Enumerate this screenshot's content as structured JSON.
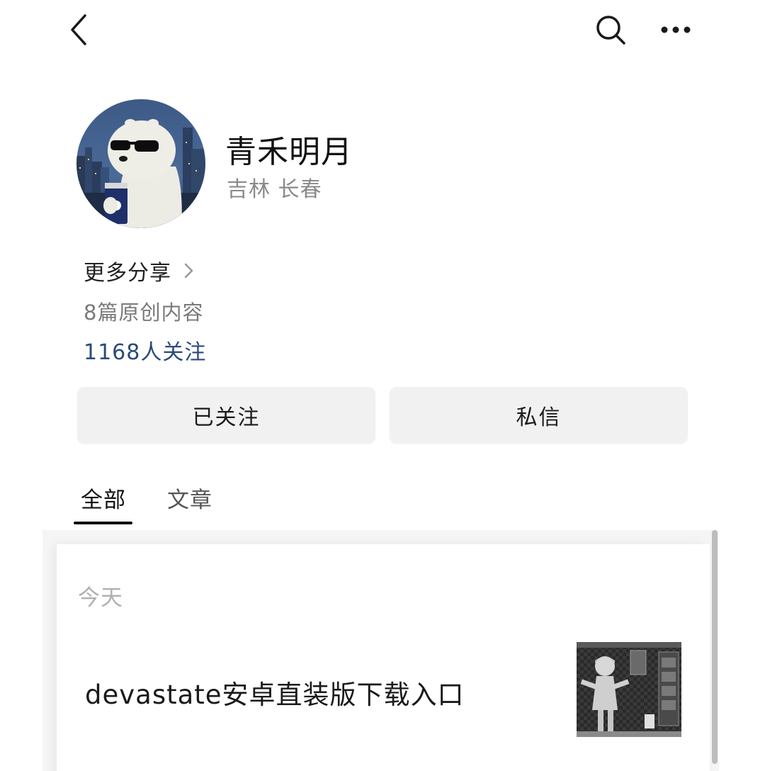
{
  "topbar": {
    "back_icon": "chevron-left-icon",
    "search_icon": "search-icon",
    "more_icon": "more-horizontal-icon"
  },
  "profile": {
    "name": "青禾明月",
    "location": "吉林 长春",
    "avatar_icon": "polar-bear-avatar"
  },
  "info": {
    "more_share": "更多分享",
    "original_count": "8篇原创内容",
    "followers": "1168人关注"
  },
  "actions": {
    "followed": "已关注",
    "message": "私信"
  },
  "tabs": [
    {
      "label": "全部",
      "active": true
    },
    {
      "label": "文章",
      "active": false
    }
  ],
  "feed": {
    "date_label": "今天",
    "articles": [
      {
        "title": "devastate安卓直装版下载入口"
      }
    ]
  },
  "colors": {
    "followers_link": "#2b4a7a",
    "button_bg": "#f1f1f1",
    "muted_text": "#8a8a8a"
  }
}
